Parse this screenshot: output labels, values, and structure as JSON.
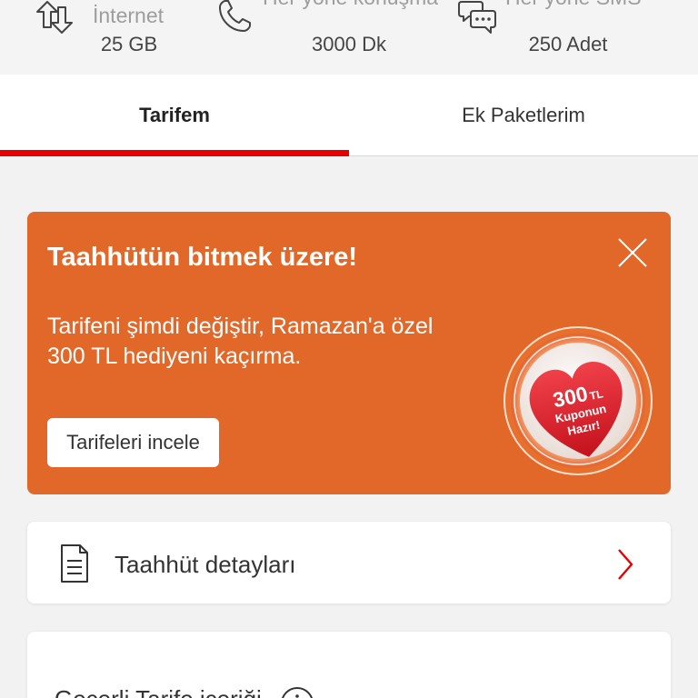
{
  "usage": {
    "items": [
      {
        "icon": "data-transfer-icon",
        "label": "İnternet",
        "value": "25 GB"
      },
      {
        "icon": "phone-icon",
        "label": "Her yöne konuşma",
        "value": "3000 Dk"
      },
      {
        "icon": "sms-icon",
        "label": "Her yöne SMS",
        "value": "250 Adet"
      }
    ]
  },
  "tabs": [
    {
      "label": "Tarifem",
      "active": true
    },
    {
      "label": "Ek Paketlerim",
      "active": false
    }
  ],
  "promo": {
    "title": "Taahhütün bitmek üzere!",
    "body": "Tarifeni şimdi değiştir, Ramazan'a özel 300 TL hediyeni kaçırma.",
    "button_label": "Tarifeleri incele",
    "close_icon": "close-icon",
    "badge": {
      "amount": "300",
      "currency": "TL",
      "line1": "Kuponun",
      "line2": "Hazır!"
    }
  },
  "commitment_card": {
    "icon": "document-icon",
    "label": "Taahhüt detayları",
    "action_icon": "chevron-right-icon"
  },
  "tariff_card": {
    "label": "Geçerli Tarife içeriği",
    "info_icon": "info-icon"
  },
  "colors": {
    "accent": "#e60000",
    "promo_background": "#e2682a",
    "page_background": "#f2f2f2",
    "card_background": "#ffffff"
  }
}
